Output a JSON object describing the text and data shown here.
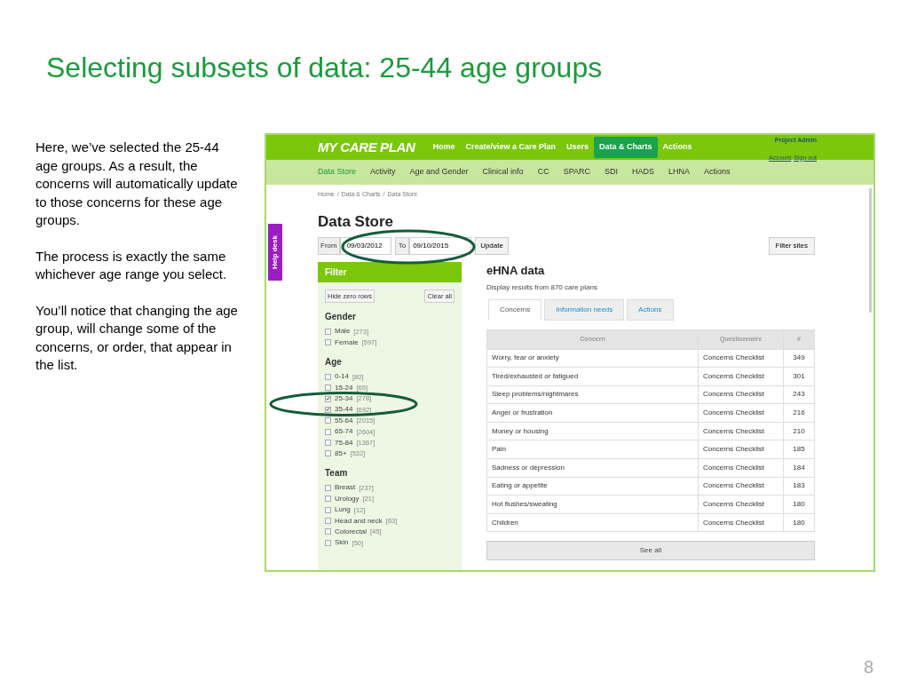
{
  "slide": {
    "title": "Selecting subsets of data: 25-44 age groups",
    "paragraphs": [
      "Here, we’ve selected the 25-44 age groups. As a result, the concerns will automatically update to those concerns for these age groups.",
      "The process is exactly the same whichever age range you select.",
      "You’ll notice that changing the age group, will change some of the concerns, or order, that appear in the list."
    ],
    "page_number": "8"
  },
  "app": {
    "logo": "MY CARE PLAN",
    "nav": [
      {
        "label": "Home",
        "selected": false
      },
      {
        "label": "Create/view a Care Plan",
        "selected": false
      },
      {
        "label": "Users",
        "selected": false
      },
      {
        "label": "Data & Charts",
        "selected": true
      },
      {
        "label": "Actions",
        "selected": false
      }
    ],
    "user": "Project Admin",
    "account_links": [
      "Account",
      "Sign out"
    ],
    "subnav": [
      {
        "label": "Data Store",
        "selected": true
      },
      {
        "label": "Activity",
        "selected": false
      },
      {
        "label": "Age and Gender",
        "selected": false
      },
      {
        "label": "Clinical info",
        "selected": false
      },
      {
        "label": "CC",
        "selected": false
      },
      {
        "label": "SPARC",
        "selected": false
      },
      {
        "label": "SDI",
        "selected": false
      },
      {
        "label": "HADS",
        "selected": false
      },
      {
        "label": "LHNA",
        "selected": false
      },
      {
        "label": "Actions",
        "selected": false
      }
    ],
    "breadcrumb": [
      "Home",
      "Data & Charts",
      "Data Store"
    ],
    "breadcrumb_separator": "/",
    "heading": "Data Store",
    "help_tab": "Help desk",
    "date_filter": {
      "from_label": "From",
      "from_value": "09/03/2012",
      "to_label": "To",
      "to_value": "09/10/2015",
      "update": "Update"
    },
    "filter_sites": "Filter sites",
    "filter": {
      "title": "Filter",
      "hide_zero": "Hide zero rows",
      "clear_all": "Clear all",
      "groups": [
        {
          "title": "Gender",
          "items": [
            {
              "label": "Male",
              "count": "[273]",
              "checked": false
            },
            {
              "label": "Female",
              "count": "[597]",
              "checked": false
            }
          ]
        },
        {
          "title": "Age",
          "items": [
            {
              "label": "0-14",
              "count": "[80]",
              "checked": false
            },
            {
              "label": "15-24",
              "count": "[65]",
              "checked": false
            },
            {
              "label": "25-34",
              "count": "[278]",
              "checked": true
            },
            {
              "label": "35-44",
              "count": "[692]",
              "checked": true
            },
            {
              "label": "55-64",
              "count": "[2015]",
              "checked": false
            },
            {
              "label": "65-74",
              "count": "[2604]",
              "checked": false
            },
            {
              "label": "75-84",
              "count": "[1367]",
              "checked": false
            },
            {
              "label": "85+",
              "count": "[532]",
              "checked": false
            }
          ]
        },
        {
          "title": "Team",
          "items": [
            {
              "label": "Breast",
              "count": "[237]",
              "checked": false
            },
            {
              "label": "Urology",
              "count": "[21]",
              "checked": false
            },
            {
              "label": "Lung",
              "count": "[12]",
              "checked": false
            },
            {
              "label": "Head and neck",
              "count": "[63]",
              "checked": false
            },
            {
              "label": "Colorectal",
              "count": "[45]",
              "checked": false
            },
            {
              "label": "Skin",
              "count": "[50]",
              "checked": false
            }
          ]
        }
      ]
    },
    "data": {
      "title": "eHNA data",
      "subtitle": "Display results from 870 care plans",
      "tabs": [
        {
          "label": "Concerns",
          "selected": true
        },
        {
          "label": "Information needs",
          "selected": false
        },
        {
          "label": "Actions",
          "selected": false
        }
      ],
      "columns": [
        "Concern",
        "Questionnaire",
        "#"
      ],
      "rows": [
        [
          "Worry, fear or anxiety",
          "Concerns Checklist",
          "349"
        ],
        [
          "Tired/exhausted or fatigued",
          "Concerns Checklist",
          "301"
        ],
        [
          "Sleep problems/nightmares",
          "Concerns Checklist",
          "243"
        ],
        [
          "Anger or frustration",
          "Concerns Checklist",
          "216"
        ],
        [
          "Money or housing",
          "Concerns Checklist",
          "210"
        ],
        [
          "Pain",
          "Concerns Checklist",
          "185"
        ],
        [
          "Sadness or depression",
          "Concerns Checklist",
          "184"
        ],
        [
          "Eating or appetite",
          "Concerns Checklist",
          "183"
        ],
        [
          "Hot flushes/sweating",
          "Concerns Checklist",
          "180"
        ],
        [
          "Children",
          "Concerns Checklist",
          "180"
        ]
      ],
      "see_all": "See all"
    }
  }
}
